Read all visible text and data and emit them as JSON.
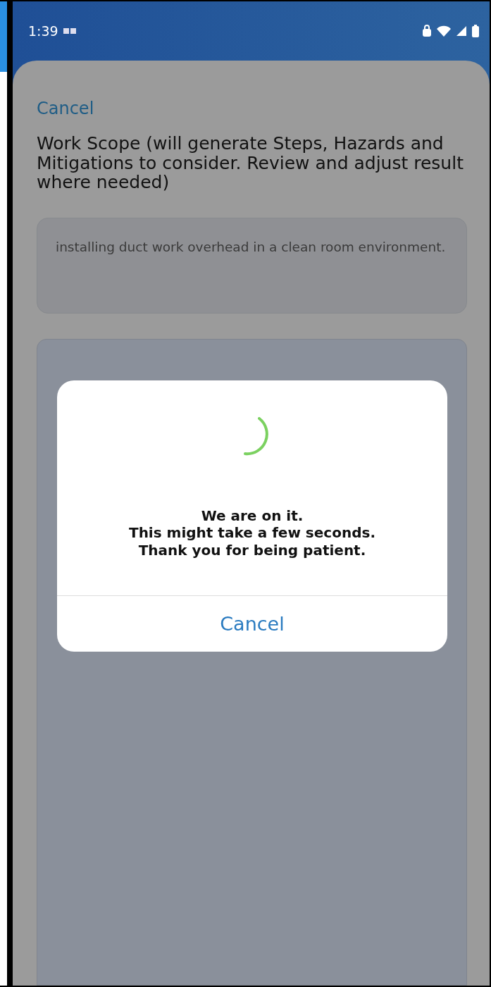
{
  "status_bar": {
    "time": "1:39"
  },
  "sheet": {
    "cancel_link": "Cancel",
    "heading": "Work Scope (will generate Steps, Hazards and Mitigations to consider. Review and adjust result where needed)",
    "scope_field": {
      "value": "installing duct work overhead in a clean room environment."
    }
  },
  "dialog": {
    "message_lines": [
      "We are on it.",
      "This might take a few seconds.",
      "Thank you for being patient."
    ],
    "cancel_button": "Cancel"
  }
}
